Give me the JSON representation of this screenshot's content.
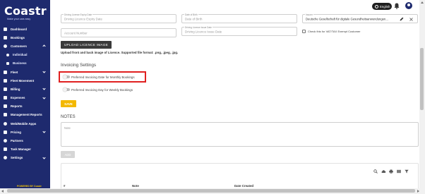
{
  "brand": {
    "name": "Coastr",
    "tagline": "Make your cars easy"
  },
  "sidebar": {
    "items": [
      {
        "label": "Dashboard",
        "icon": "dashboard-icon"
      },
      {
        "label": "Bookings",
        "icon": "bookings-icon"
      },
      {
        "label": "Customers",
        "icon": "customers-icon"
      },
      {
        "label": "Individual",
        "icon": "individual-icon"
      },
      {
        "label": "Business",
        "icon": "business-icon"
      },
      {
        "label": "Fleet",
        "icon": "fleet-icon"
      },
      {
        "label": "Fleet Movement",
        "icon": "fleet-movement-icon"
      },
      {
        "label": "Billing",
        "icon": "billing-icon"
      },
      {
        "label": "Expenses",
        "icon": "expenses-icon"
      },
      {
        "label": "Reports",
        "icon": "reports-icon"
      },
      {
        "label": "Management Reports",
        "icon": "management-reports-icon"
      },
      {
        "label": "Web/Mobile Apps",
        "icon": "apps-icon"
      },
      {
        "label": "Pricing",
        "icon": "pricing-icon"
      },
      {
        "label": "Partners",
        "icon": "partners-icon"
      },
      {
        "label": "Task Manager",
        "icon": "task-manager-icon"
      },
      {
        "label": "Settings",
        "icon": "settings-icon"
      }
    ],
    "powered_by": "POWERED BY Coastr"
  },
  "header": {
    "language": "English"
  },
  "form": {
    "licence_expiry": {
      "label": "Driving License Expiry Date",
      "placeholder": "Driving Licence Expiry Date"
    },
    "dob": {
      "label": "Date of Birth",
      "placeholder": "Date of Birth"
    },
    "insurer": {
      "label": "Insurer",
      "value": "Deutsche Gesellschaft für digitale Gesundheitsanwendungen..."
    },
    "account_number": {
      "placeholder": "Account Number"
    },
    "licence_issue": {
      "label": "Driving Licence Issue Date",
      "placeholder": "Driving Licence Issue Date"
    },
    "vat_exempt_label": "Check this for VAT/TAX Exempt Customer",
    "upload_button": "UPLOAD LICENCE IMAGE",
    "upload_note": "Upload front and back image of Licence. Supported file format: .png, .jpeg, .jpg."
  },
  "invoicing": {
    "title": "Invoicing Settings",
    "monthly_label": "Preferred Invoicing Date for Monthly Bookings",
    "weekly_label": "Preferred Invoicing Day for Weekly Bookings",
    "save": "SAVE"
  },
  "notes": {
    "title": "NOTES",
    "placeholder": "Note",
    "add": "ADD",
    "columns": [
      "#",
      "Note",
      "Date Created"
    ]
  },
  "colors": {
    "sidebar": "#1e2a6e",
    "accent": "#f3b800",
    "highlight": "#e02020"
  }
}
